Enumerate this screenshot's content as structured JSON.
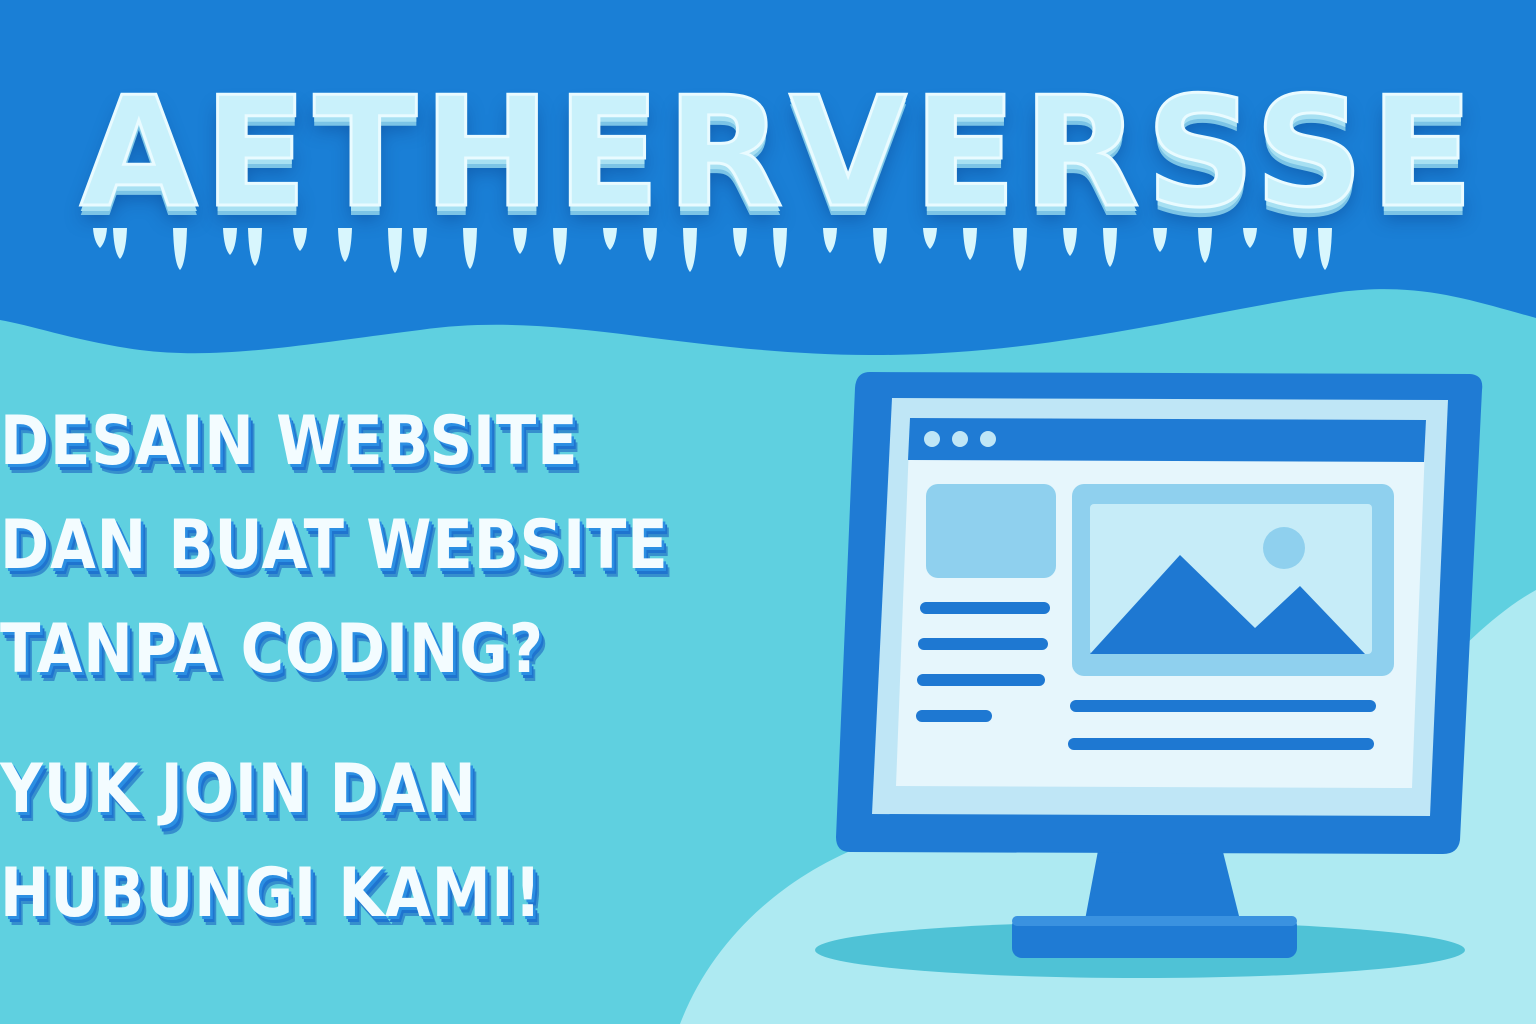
{
  "brand": {
    "name": "AETHERVERSSE"
  },
  "headline": {
    "question_lines": [
      "DESAIN WEBSITE",
      "DAN BUAT WEBSITE",
      "TANPA CODING?"
    ],
    "cta_lines": [
      "YUK JOIN DAN",
      "HUBUNGI KAMI!"
    ]
  },
  "illustration": {
    "icon": "desktop-monitor-icon",
    "screen_content": [
      "browser-window",
      "image-placeholder-icon",
      "text-lines"
    ]
  },
  "colors": {
    "top_band": "#1a7fd6",
    "background": "#5fd0e0",
    "light_blob": "#aeeaf2",
    "monitor_frame": "#1f7bd4",
    "screen": "#e6f6fc",
    "accent_blue": "#1e78d2"
  }
}
